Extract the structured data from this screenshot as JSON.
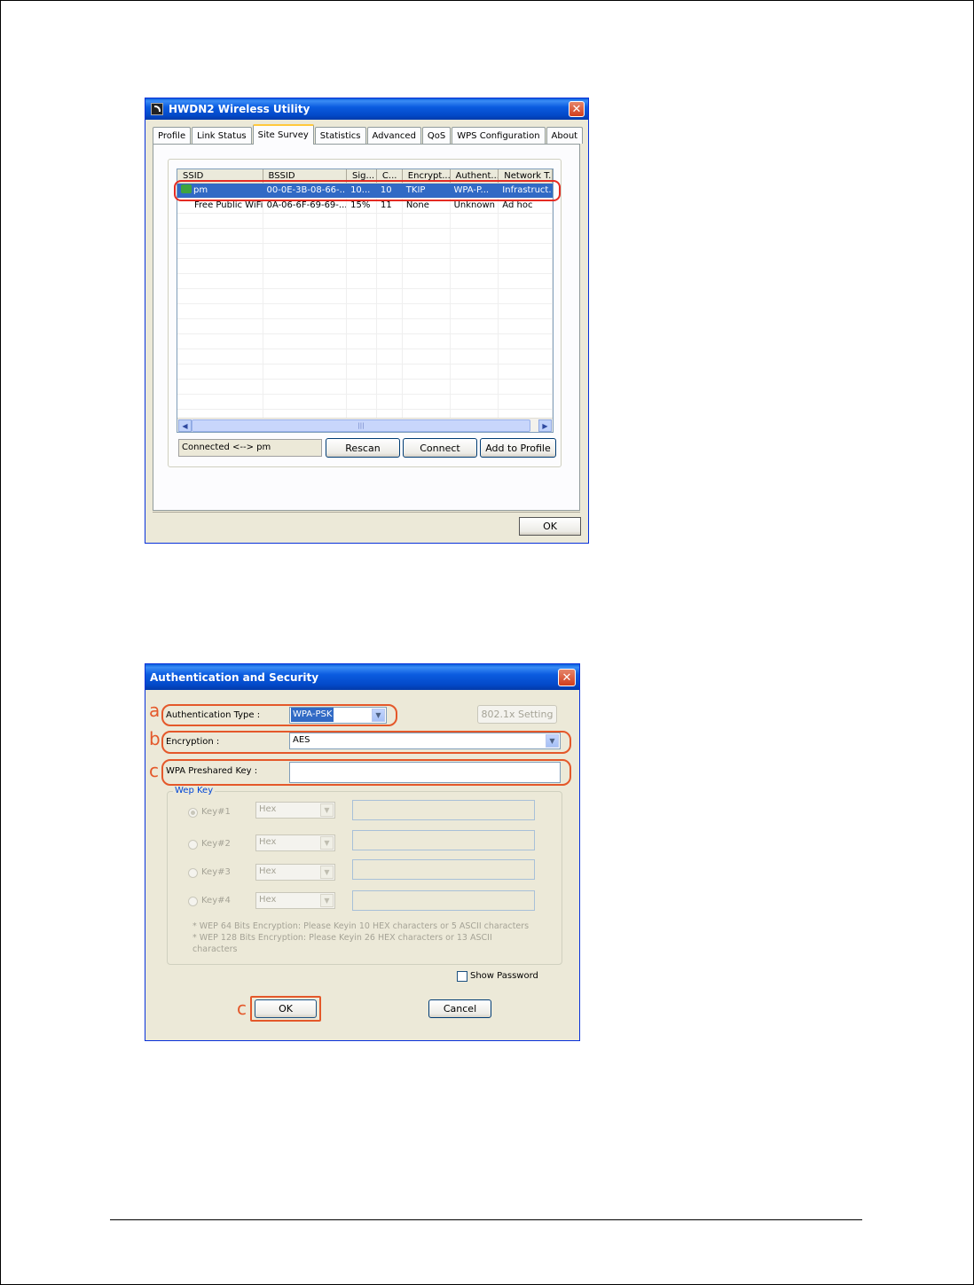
{
  "site_survey_window": {
    "title": "HWDN2 Wireless Utility",
    "tabs": [
      "Profile",
      "Link Status",
      "Site Survey",
      "Statistics",
      "Advanced",
      "QoS",
      "WPS Configuration",
      "About"
    ],
    "active_tab": "Site Survey",
    "columns": [
      "SSID",
      "BSSID",
      "Sig...",
      "C...",
      "Encrypt...",
      "Authent...",
      "Network T..."
    ],
    "rows": [
      [
        "pm",
        "00-0E-3B-08-66-...",
        "10...",
        "10",
        "TKIP",
        "WPA-P...",
        "Infrastruct..."
      ],
      [
        "Free Public WiFi",
        "0A-06-6F-69-69-...",
        "15%",
        "11",
        "None",
        "Unknown",
        "Ad hoc"
      ]
    ],
    "status_text": "Connected <--> pm",
    "rescan_label": "Rescan",
    "connect_label": "Connect",
    "add_profile_label": "Add to Profile",
    "ok_label": "OK"
  },
  "auth_window": {
    "title": "Authentication and Security",
    "auth_type_label": "Authentication Type :",
    "auth_type_value": "WPA-PSK",
    "setting_8021x_label": "802.1x Setting",
    "encryption_label": "Encryption :",
    "encryption_value": "AES",
    "psk_label": "WPA Preshared Key :",
    "psk_value": "",
    "wep_key_legend": "Wep Key",
    "wep_keys": [
      {
        "label": "Key#1",
        "format": "Hex"
      },
      {
        "label": "Key#2",
        "format": "Hex"
      },
      {
        "label": "Key#3",
        "format": "Hex"
      },
      {
        "label": "Key#4",
        "format": "Hex"
      }
    ],
    "note_line1": "* WEP 64 Bits Encryption:  Please Keyin 10 HEX characters or 5 ASCII characters",
    "note_line2": "* WEP 128 Bits Encryption:  Please Keyin 26 HEX characters or 13 ASCII",
    "note_line3": "characters",
    "show_password_label": "Show Password",
    "ok_label": "OK",
    "cancel_label": "Cancel"
  },
  "markers": {
    "a": "a",
    "b": "b",
    "c1": "c",
    "c2": "c"
  },
  "colors": {
    "highlight_red": "#e42b23",
    "highlight_orange": "#e4582a",
    "selection_blue": "#316ac5"
  }
}
